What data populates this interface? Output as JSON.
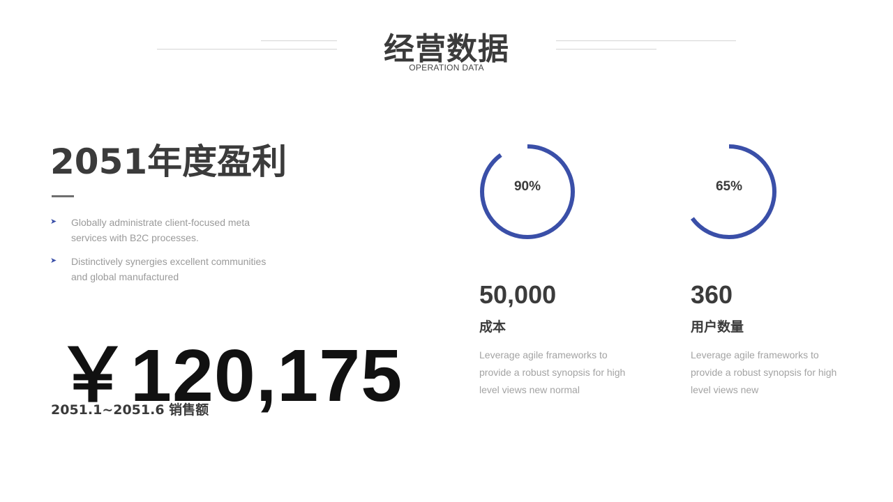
{
  "header": {
    "title": "经营数据",
    "subtitle": "OPERATION DATA"
  },
  "profit": {
    "title": "2051年度盈利",
    "bullets": [
      {
        "text": "Globally administrate client-focused meta services with B2C processes."
      },
      {
        "text": "Distinctively synergies excellent communities and global manufactured"
      }
    ],
    "amount": "￥120,175",
    "caption": "2051.1~2051.6 销售额"
  },
  "stats": [
    {
      "percent_label": "90%",
      "progress": 0.9,
      "value": "50,000",
      "label": "成本",
      "desc": "Leverage agile frameworks to provide a robust synopsis for high level views new normal"
    },
    {
      "percent_label": "65%",
      "progress": 0.65,
      "value": "360",
      "label": "用户数量",
      "desc": "Leverage agile frameworks to provide a robust synopsis for high level views new"
    }
  ],
  "colors": {
    "accent": "#3a4fa8",
    "text_dark": "#3b3b3b",
    "text_muted": "#9a9a9a"
  }
}
